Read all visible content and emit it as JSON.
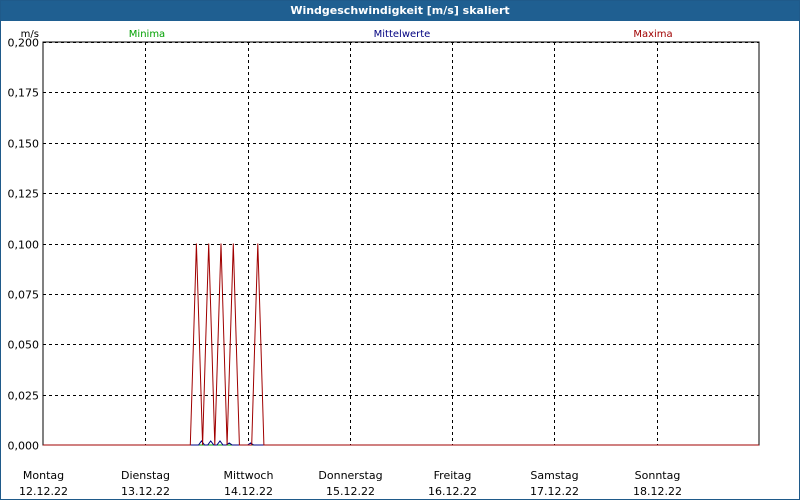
{
  "window": {
    "title": "Windgeschwindigkeit [m/s] skaliert"
  },
  "chart_data": {
    "type": "line",
    "ylabel": "m/s",
    "ylim": [
      0,
      0.2
    ],
    "yticks": [
      "0,000",
      "0,025",
      "0,050",
      "0,075",
      "0,100",
      "0,125",
      "0,150",
      "0,175",
      "0,200"
    ],
    "ytick_values": [
      0,
      0.025,
      0.05,
      0.075,
      0.1,
      0.125,
      0.15,
      0.175,
      0.2
    ],
    "xlim": [
      0,
      7
    ],
    "days": [
      {
        "name": "Montag",
        "date": "12.12.22"
      },
      {
        "name": "Dienstag",
        "date": "13.12.22"
      },
      {
        "name": "Mittwoch",
        "date": "14.12.22"
      },
      {
        "name": "Donnerstag",
        "date": "15.12.22"
      },
      {
        "name": "Freitag",
        "date": "16.12.22"
      },
      {
        "name": "Samstag",
        "date": "17.12.22"
      },
      {
        "name": "Sonntag",
        "date": "18.12.22"
      }
    ],
    "grid": true,
    "legend_position": "top",
    "series": [
      {
        "name": "Minima",
        "color": "#00a000",
        "x": [
          0,
          2.3
        ],
        "y": [
          0,
          0
        ]
      },
      {
        "name": "Mittelwerte",
        "color": "#000080",
        "x": [
          0,
          1.52,
          1.55,
          1.58,
          1.61,
          1.64,
          1.67,
          1.7,
          1.73,
          1.76,
          1.79,
          1.82,
          1.85,
          1.88,
          1.91,
          1.94,
          1.97,
          2.0,
          2.03,
          2.06,
          2.09,
          2.12,
          2.15,
          2.3
        ],
        "y": [
          0,
          0,
          0.002,
          0,
          0,
          0.002,
          0,
          0,
          0.002,
          0,
          0,
          0.001,
          0,
          0,
          0,
          0,
          0,
          0,
          0.001,
          0,
          0,
          0,
          0,
          0
        ]
      },
      {
        "name": "Maxima",
        "color": "#a00000",
        "x": [
          0,
          1.44,
          1.47,
          1.5,
          1.53,
          1.56,
          1.59,
          1.62,
          1.65,
          1.68,
          1.71,
          1.74,
          1.77,
          1.8,
          1.83,
          1.86,
          1.89,
          1.92,
          1.95,
          1.98,
          2.01,
          2.04,
          2.07,
          2.1,
          2.13,
          2.16,
          2.19,
          7
        ],
        "y": [
          0,
          0,
          0.05,
          0.1,
          0.05,
          0,
          0.05,
          0.1,
          0.05,
          0,
          0.05,
          0.1,
          0.05,
          0,
          0.05,
          0.1,
          0.05,
          0,
          0,
          0,
          0,
          0,
          0.05,
          0.1,
          0.05,
          0,
          0,
          0
        ]
      }
    ]
  }
}
